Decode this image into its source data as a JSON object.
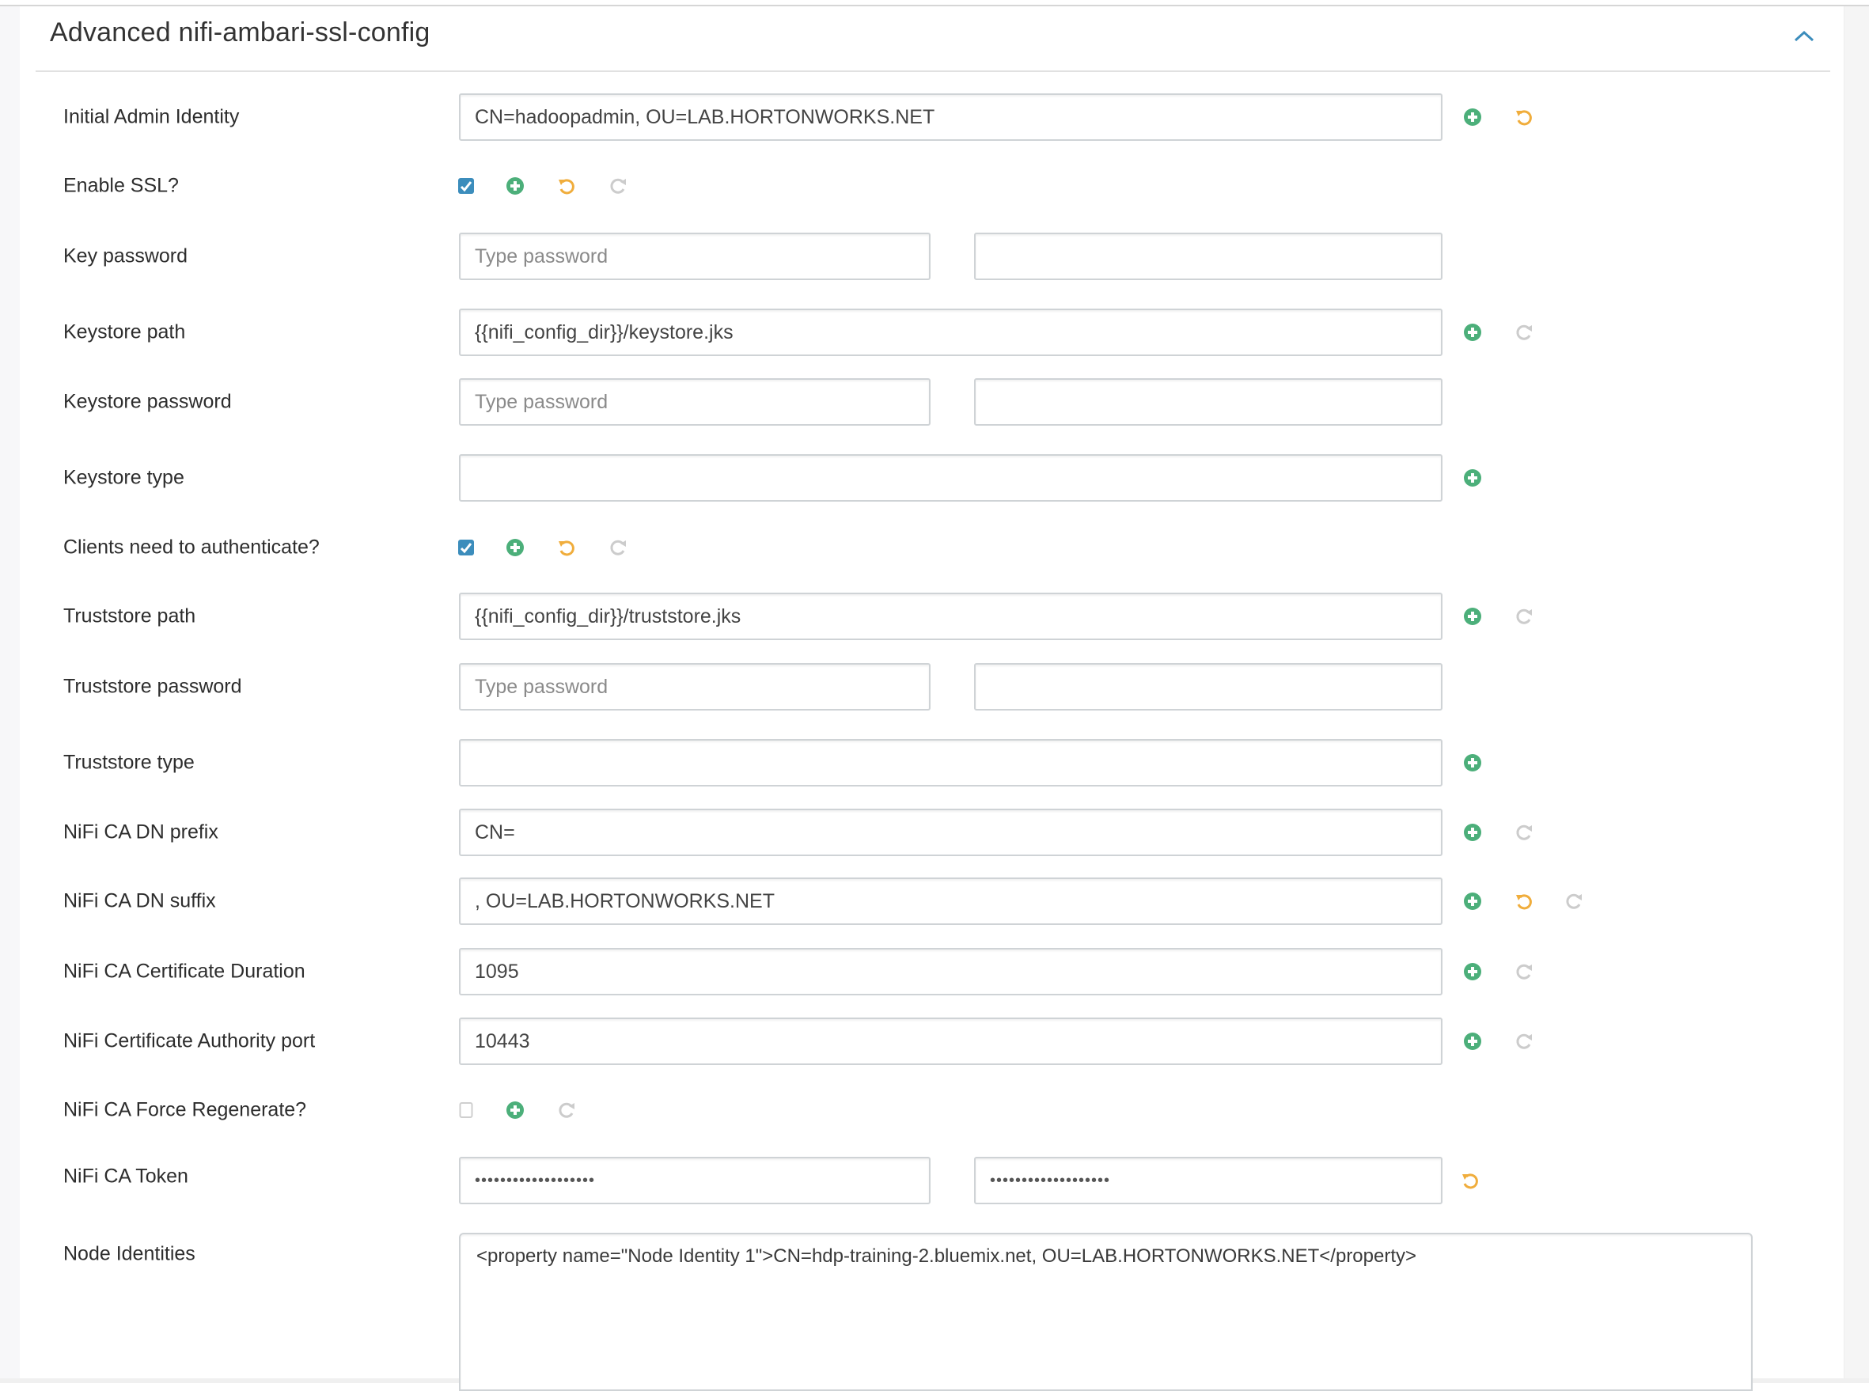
{
  "panel": {
    "title": "Advanced nifi-ambari-ssl-config",
    "collapse_icon": "chevron-up-icon"
  },
  "colors": {
    "accent_blue": "#3c8dbc",
    "add_green": "#4caf7a",
    "undo_orange": "#f0ad3c",
    "disabled_gray": "#cccccc"
  },
  "fields": {
    "initial_admin_identity": {
      "label": "Initial Admin Identity",
      "value": "CN=hadoopadmin, OU=LAB.HORTONWORKS.NET"
    },
    "enable_ssl": {
      "label": "Enable SSL?",
      "checked": true
    },
    "key_password": {
      "label": "Key password",
      "placeholder": "Type password",
      "confirm_value": ""
    },
    "keystore_path": {
      "label": "Keystore path",
      "value": "{{nifi_config_dir}}/keystore.jks"
    },
    "keystore_password": {
      "label": "Keystore password",
      "placeholder": "Type password",
      "confirm_value": ""
    },
    "keystore_type": {
      "label": "Keystore type",
      "value": ""
    },
    "clients_need_auth": {
      "label": "Clients need to authenticate?",
      "checked": true
    },
    "truststore_path": {
      "label": "Truststore path",
      "value": "{{nifi_config_dir}}/truststore.jks"
    },
    "truststore_password": {
      "label": "Truststore password",
      "placeholder": "Type password",
      "confirm_value": ""
    },
    "truststore_type": {
      "label": "Truststore type",
      "value": ""
    },
    "ca_dn_prefix": {
      "label": "NiFi CA DN prefix",
      "value": "CN="
    },
    "ca_dn_suffix": {
      "label": "NiFi CA DN suffix",
      "value": ", OU=LAB.HORTONWORKS.NET"
    },
    "ca_cert_duration": {
      "label": "NiFi CA Certificate Duration",
      "value": "1095"
    },
    "ca_port": {
      "label": "NiFi Certificate Authority port",
      "value": "10443"
    },
    "ca_force_regenerate": {
      "label": "NiFi CA Force Regenerate?",
      "checked": false
    },
    "ca_token": {
      "label": "NiFi CA Token",
      "masked_value": "•••••••••••••••••••",
      "confirm_masked_value": "•••••••••••••••••••"
    },
    "node_identities": {
      "label": "Node Identities",
      "value": "<property name=\"Node Identity 1\">CN=hdp-training-2.bluemix.net, OU=LAB.HORTONWORKS.NET</property>"
    }
  },
  "actions": {
    "add_override": "plus-circle-icon",
    "undo": "undo-icon",
    "set_recommended": "redo-icon"
  }
}
